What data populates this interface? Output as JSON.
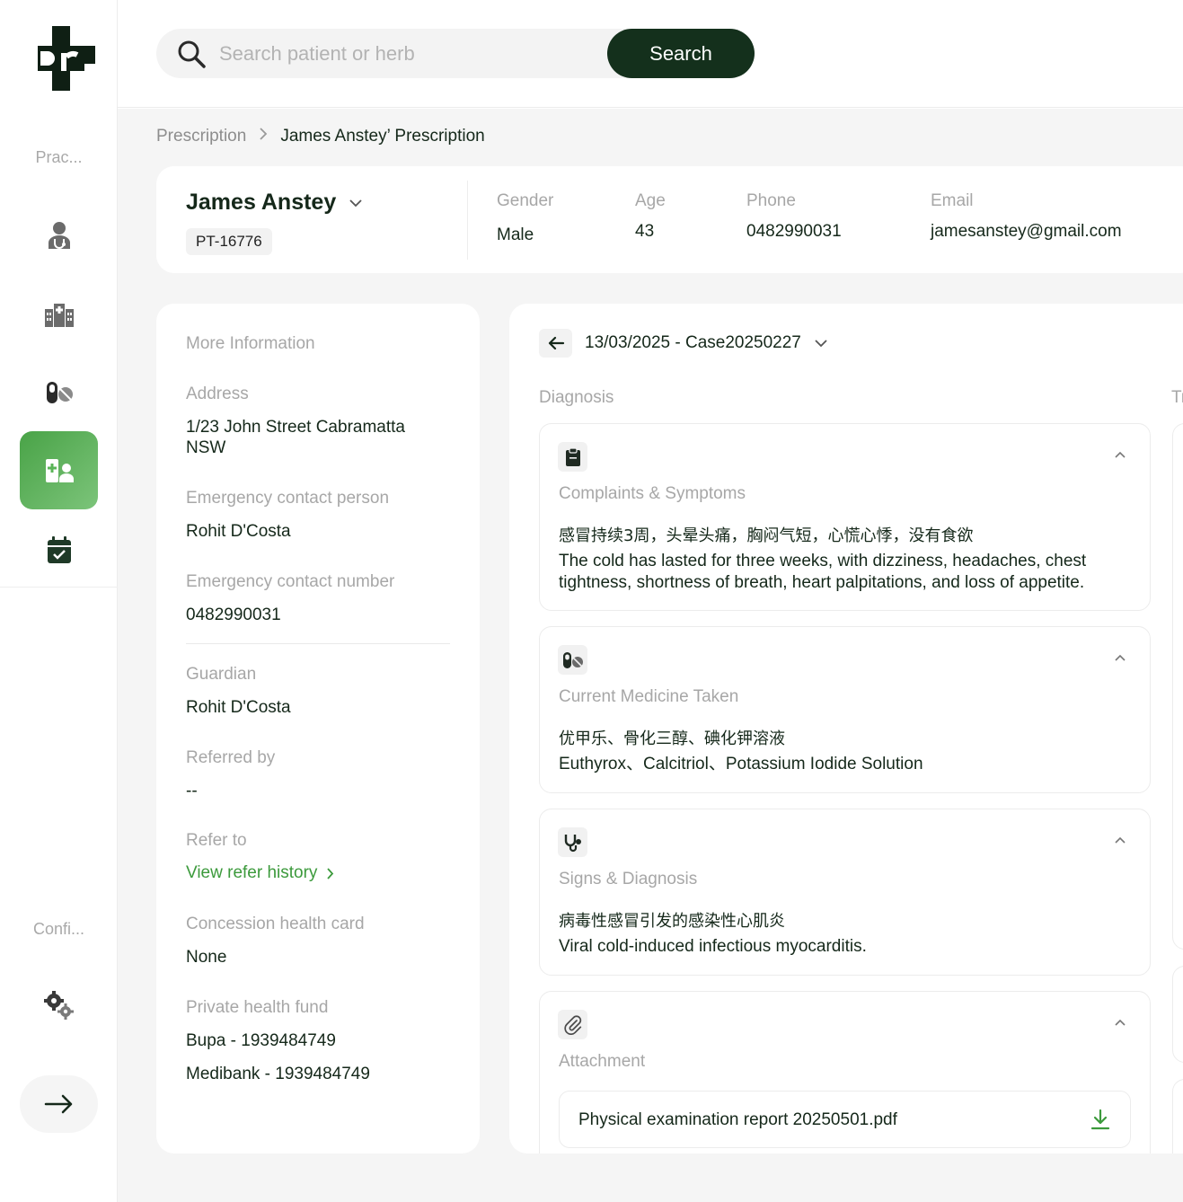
{
  "sidebar": {
    "practice_label": "Prac...",
    "config_label": "Confi...",
    "items": [
      {
        "icon": "doctor-icon"
      },
      {
        "icon": "hospital-icon"
      },
      {
        "icon": "pills-icon"
      },
      {
        "icon": "patient-record-icon",
        "active": true
      },
      {
        "icon": "calendar-check-icon"
      }
    ],
    "settings_icon": "gears-icon",
    "logout_icon": "arrow-right-icon"
  },
  "search": {
    "placeholder": "Search patient or herb",
    "value": "",
    "button_label": "Search"
  },
  "breadcrumb": {
    "parent": "Prescription",
    "current": "James Anstey’ Prescription"
  },
  "patient": {
    "name": "James Anstey",
    "id": "PT-16776",
    "gender_label": "Gender",
    "gender": "Male",
    "age_label": "Age",
    "age": "43",
    "phone_label": "Phone",
    "phone": "0482990031",
    "email_label": "Email",
    "email": "jamesanstey@gmail.com"
  },
  "more_info": {
    "title": "More Information",
    "address_label": "Address",
    "address": "1/23 John Street Cabramatta NSW",
    "emergency_person_label": "Emergency contact person",
    "emergency_person": "Rohit D'Costa",
    "emergency_number_label": "Emergency contact number",
    "emergency_number": "0482990031",
    "guardian_label": "Guardian",
    "guardian": "Rohit D'Costa",
    "referred_by_label": "Referred by",
    "referred_by": "--",
    "refer_to_label": "Refer to",
    "refer_history_link": "View refer history",
    "concession_label": "Concession health card",
    "concession": "None",
    "private_fund_label": "Private health fund",
    "private_funds": [
      "Bupa - 1939484749",
      "Medibank - 1939484749"
    ]
  },
  "case": {
    "selector": "13/03/2025 - Case20250227",
    "diagnosis_title": "Diagnosis",
    "treatment_title_partial": "Tr",
    "sections": {
      "complaints": {
        "icon": "clipboard-icon",
        "title": "Complaints & Symptoms",
        "zh": "感冒持续3周，头晕头痛，胸闷气短，心慌心悸，没有食欲",
        "en": "The cold has lasted for three weeks, with dizziness, headaches, chest tightness, shortness of breath, heart palpitations, and loss of appetite."
      },
      "medicine": {
        "icon": "pills-icon",
        "title": "Current Medicine Taken",
        "zh": "优甲乐、骨化三醇、碘化钾溶液",
        "en": "Euthyrox、Calcitriol、Potassium Iodide Solution"
      },
      "signs": {
        "icon": "stethoscope-icon",
        "title": "Signs & Diagnosis",
        "zh": "病毒性感冒引发的感染性心肌炎",
        "en": "Viral cold-induced infectious myocarditis."
      },
      "attachment": {
        "icon": "paperclip-icon",
        "title": "Attachment",
        "file_name": "Physical examination report 20250501.pdf"
      }
    }
  },
  "colors": {
    "brand_dark": "#14301c",
    "accent_green": "#49a347",
    "link_green": "#3c9a3c",
    "muted_text": "#a7a7a7"
  }
}
